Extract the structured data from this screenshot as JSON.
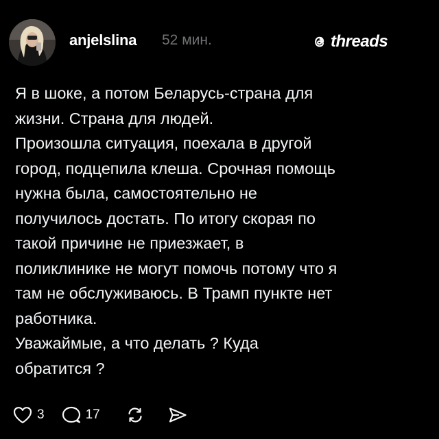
{
  "post": {
    "username": "anjelslina",
    "time": "52 мин.",
    "brand": "threads",
    "avatar": "user-avatar-photo",
    "paragraphs": [
      [
        "Я в шоке, а потом Беларусь-страна для",
        "жизни. Страна для людей."
      ],
      [
        "Произошла ситуация, поехала в другой",
        "город, подцепила клеша. Срочная помощь",
        "нужна была, самостоятельно не",
        "получилось достать. По итогу скорая по",
        "такой причине не приезжает, в",
        "поликлинике не могут помочь потому что я",
        "там не обслуживаюсь. В Трамп пункте нет",
        "работника."
      ],
      [
        "Уважаймые, а что делать ? Куда",
        "обратится ?"
      ]
    ]
  },
  "actions": {
    "like_count": "3",
    "comment_count": "17",
    "icons": [
      "heart-icon",
      "comment-icon",
      "repost-icon",
      "share-icon"
    ]
  },
  "colors": {
    "background": "#000000",
    "text": "#f3f5f7",
    "muted": "#6f7173"
  }
}
